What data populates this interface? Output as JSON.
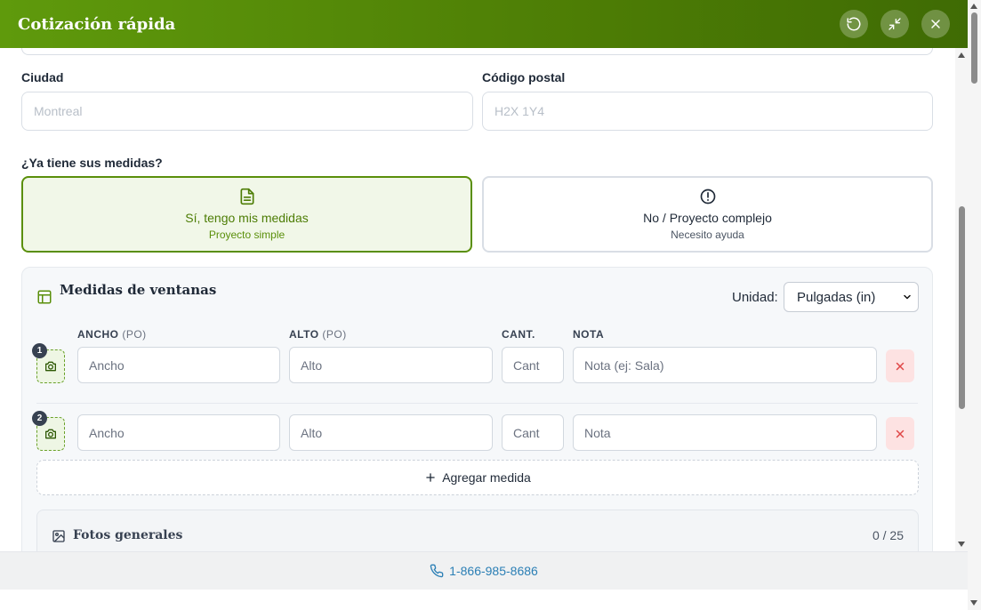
{
  "header": {
    "title": "Cotización rápida"
  },
  "address": {
    "city_label": "Ciudad",
    "city_placeholder": "Montreal",
    "postal_label": "Código postal",
    "postal_placeholder": "H2X 1Y4"
  },
  "measures_question": "¿Ya tiene sus medidas?",
  "choices": {
    "yes_title": "Sí, tengo mis medidas",
    "yes_sub": "Proyecto simple",
    "no_title": "No / Proyecto complejo",
    "no_sub": "Necesito ayuda"
  },
  "panel": {
    "title": "Medidas de ventanas",
    "unit_label": "Unidad:",
    "unit_value": "Pulgadas (in)",
    "columns": {
      "width": "ANCHO",
      "width_unit": "(PO)",
      "height": "ALTO",
      "height_unit": "(PO)",
      "qty": "CANT.",
      "note": "NOTA"
    },
    "rows": [
      {
        "number": "1",
        "width": "Ancho",
        "height": "Alto",
        "qty": "Cant",
        "note": "Nota (ej: Sala)"
      },
      {
        "number": "2",
        "width": "Ancho",
        "height": "Alto",
        "qty": "Cant",
        "note": "Nota"
      }
    ],
    "add_label": "Agregar medida",
    "photos_title": "Fotos generales",
    "photos_count": "0 / 25"
  },
  "footer": {
    "phone": "1-866-985-8686"
  },
  "colors": {
    "brand": "#5a8f0a",
    "danger": "#e04848",
    "link": "#2b7fb5"
  }
}
